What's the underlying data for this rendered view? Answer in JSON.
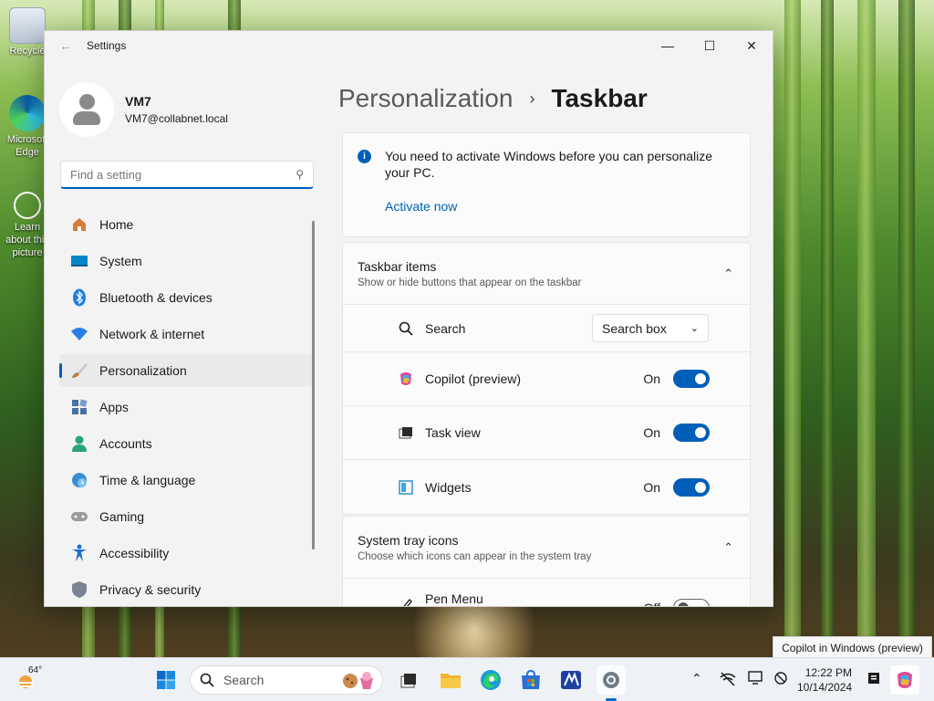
{
  "desktop": {
    "icons": [
      {
        "label": "Recycle",
        "name": "recycle-bin"
      },
      {
        "label": "Microsoft Edge",
        "name": "edge"
      },
      {
        "label": "Learn about this picture",
        "name": "learn-picture"
      }
    ]
  },
  "window": {
    "title": "Settings",
    "controls": {
      "minimize": "—",
      "maximize": "☐",
      "close": "✕"
    }
  },
  "profile": {
    "name": "VM7",
    "email": "VM7@collabnet.local"
  },
  "search": {
    "placeholder": "Find a setting"
  },
  "nav": {
    "items": [
      {
        "label": "Home",
        "icon": "home-icon",
        "color": "#d97b3c"
      },
      {
        "label": "System",
        "icon": "system-icon",
        "color": "#0a84c8"
      },
      {
        "label": "Bluetooth & devices",
        "icon": "bluetooth-icon",
        "color": "#1f7fe0"
      },
      {
        "label": "Network & internet",
        "icon": "wifi-icon",
        "color": "#2a7ee8"
      },
      {
        "label": "Personalization",
        "icon": "paintbrush-icon",
        "color": "#c07a3a",
        "active": true
      },
      {
        "label": "Apps",
        "icon": "apps-icon",
        "color": "#4a6fa5"
      },
      {
        "label": "Accounts",
        "icon": "accounts-icon",
        "color": "#2aa37a"
      },
      {
        "label": "Time & language",
        "icon": "clock-globe-icon",
        "color": "#3a8fd0"
      },
      {
        "label": "Gaming",
        "icon": "gamepad-icon",
        "color": "#7a7a7a"
      },
      {
        "label": "Accessibility",
        "icon": "accessibility-icon",
        "color": "#1e6fd1"
      },
      {
        "label": "Privacy & security",
        "icon": "shield-icon",
        "color": "#7a8490"
      }
    ]
  },
  "breadcrumb": {
    "parent": "Personalization",
    "separator": "›",
    "current": "Taskbar"
  },
  "notice": {
    "text": "You need to activate Windows before you can personalize your PC.",
    "link": "Activate now"
  },
  "taskbar_items": {
    "title": "Taskbar items",
    "description": "Show or hide buttons that appear on the taskbar",
    "rows": [
      {
        "label": "Search",
        "control": "dropdown",
        "value": "Search box"
      },
      {
        "label": "Copilot (preview)",
        "control": "toggle",
        "state": "On",
        "on": true
      },
      {
        "label": "Task view",
        "control": "toggle",
        "state": "On",
        "on": true
      },
      {
        "label": "Widgets",
        "control": "toggle",
        "state": "On",
        "on": true
      }
    ]
  },
  "system_tray": {
    "title": "System tray icons",
    "description": "Choose which icons can appear in the system tray",
    "rows": [
      {
        "label": "Pen Menu",
        "control": "toggle",
        "state": "Off",
        "on": false
      }
    ]
  },
  "taskbar": {
    "weather": "64°",
    "search_label": "Search",
    "time": "12:22 PM",
    "date": "10/14/2024",
    "tooltip": "Copilot in Windows (preview)"
  },
  "colors": {
    "accent": "#005fb8"
  }
}
